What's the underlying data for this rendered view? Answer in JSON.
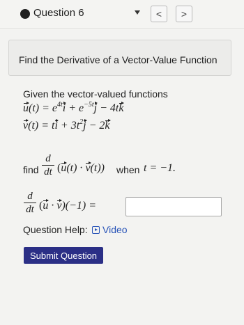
{
  "header": {
    "question_label": "Question 6",
    "prev_label": "<",
    "next_label": ">"
  },
  "title": "Find the Derivative of a Vector-Value Function",
  "prompt": "Given the vector-valued functions",
  "eq_u": {
    "u": "u",
    "lhs_rest": "(t) = e",
    "exp1": "4t",
    "i": "i",
    "plus": " + e",
    "exp2": "−5t",
    "j": "j",
    "rest": " − 4t",
    "k": "k"
  },
  "eq_v": {
    "v": "v",
    "lhs_rest": "(t) = t",
    "i": "i",
    "mid": " + 3t",
    "exp": "2",
    "j": "j",
    "rest": " − 2",
    "k": "k"
  },
  "find_label": "find",
  "frac": {
    "num": "d",
    "den": "dt"
  },
  "find_expr": {
    "open": "(",
    "u": "u",
    "dot": "(t) · ",
    "v": "v",
    "close": "(t))"
  },
  "when_text": "when",
  "when_eq": "t = −1.",
  "answer_expr": {
    "open": "(",
    "u": "u",
    "dot": " · ",
    "v": "v",
    "close": ")(−1) ="
  },
  "answer": {
    "value": "",
    "placeholder": ""
  },
  "help_label": "Question Help:",
  "video_label": "Video",
  "submit_label": "Submit Question"
}
